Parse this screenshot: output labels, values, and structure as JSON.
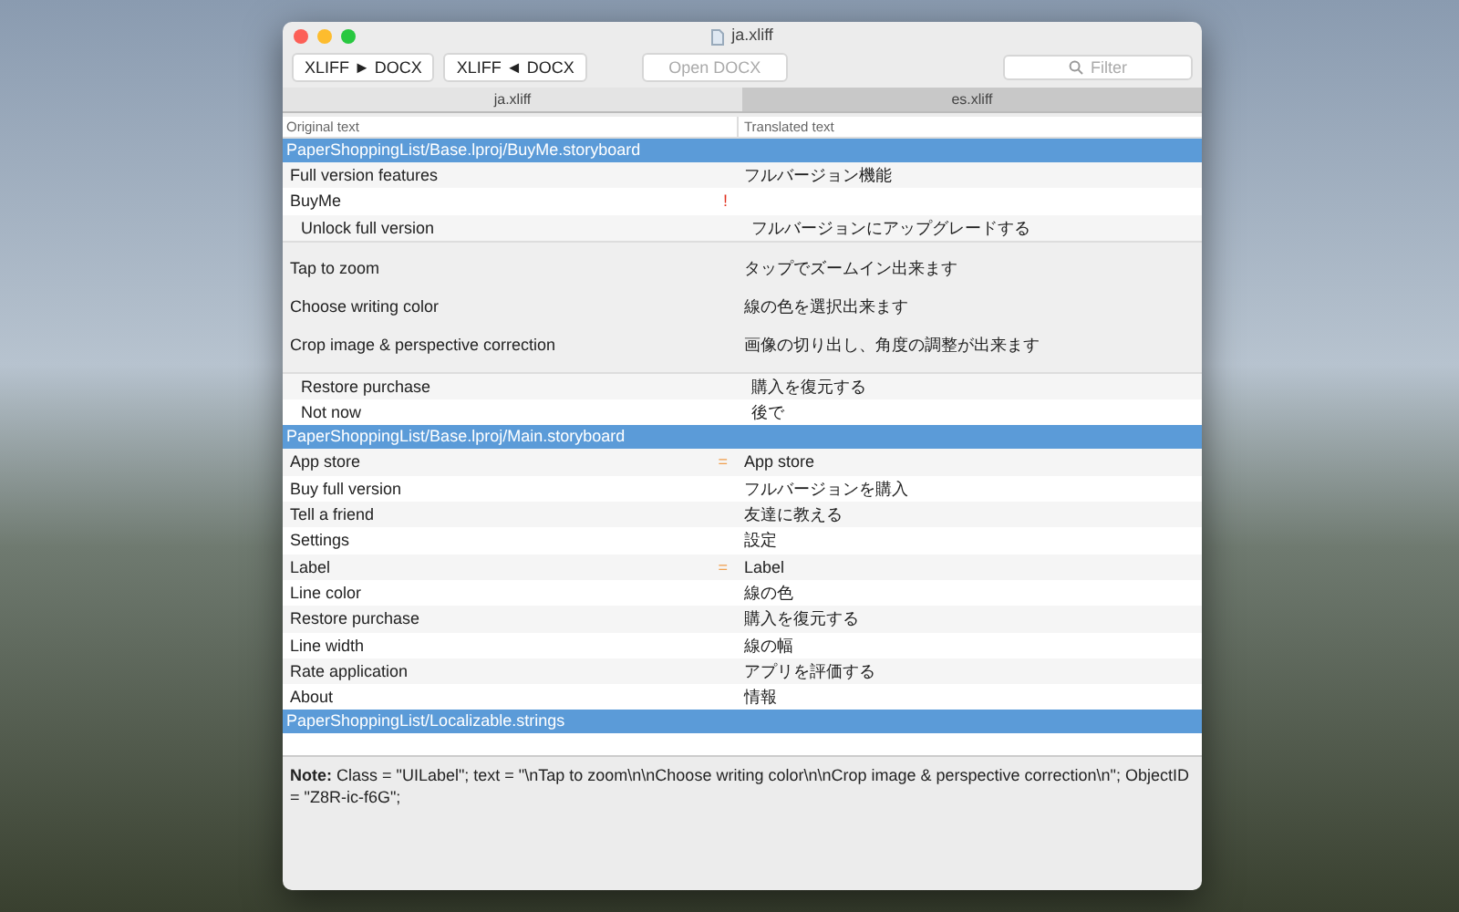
{
  "window": {
    "title": "ja.xliff"
  },
  "toolbar": {
    "buttons": [
      {
        "label": "XLIFF ► DOCX",
        "disabled": false
      },
      {
        "label": "XLIFF ◄ DOCX",
        "disabled": false
      },
      {
        "label": "Open DOCX",
        "disabled": true
      }
    ],
    "search": {
      "placeholder": "Filter"
    }
  },
  "tabs": [
    {
      "label": "ja.xliff",
      "selected": true
    },
    {
      "label": "es.xliff",
      "selected": false
    }
  ],
  "table": {
    "columns": [
      "Original text",
      "Translated text"
    ],
    "groups": [
      {
        "title": "PaperShoppingList/Base.lproj/BuyMe.storyboard",
        "rows": [
          {
            "kind": "row",
            "original": "Full version features",
            "translated": "フルバージョン機能"
          },
          {
            "kind": "row",
            "original": "BuyMe",
            "marker": "!",
            "translated": "",
            "children": [
              {
                "kind": "row",
                "original": "Unlock full version",
                "translated": "フルバージョンにアップグレードする"
              },
              {
                "kind": "block",
                "original_lines": [
                  "Tap to zoom",
                  "Choose writing color",
                  "Crop image & perspective correction"
                ],
                "translated_lines": [
                  "タップでズームイン出来ます",
                  "線の色を選択出来ます",
                  "画像の切り出し、角度の調整が出来ます"
                ],
                "selected": true
              },
              {
                "kind": "row",
                "original": "Restore purchase",
                "translated": "購入を復元する"
              },
              {
                "kind": "row",
                "original": "Not now",
                "translated": "後で"
              }
            ]
          }
        ]
      },
      {
        "title": "PaperShoppingList/Base.lproj/Main.storyboard",
        "rows": [
          {
            "kind": "row",
            "original": "App store",
            "marker": "=",
            "translated": "App store"
          },
          {
            "kind": "row",
            "original": "Buy full version",
            "translated": "フルバージョンを購入"
          },
          {
            "kind": "row",
            "original": "Tell a friend",
            "translated": "友達に教える"
          },
          {
            "kind": "row",
            "original": "Settings",
            "translated": "設定"
          },
          {
            "kind": "row",
            "original": "Label",
            "marker": "=",
            "translated": "Label"
          },
          {
            "kind": "row",
            "original": "Line color",
            "translated": "線の色"
          },
          {
            "kind": "row",
            "original": "Restore purchase",
            "translated": "購入を復元する"
          },
          {
            "kind": "row",
            "original": "Line width",
            "translated": "線の幅"
          },
          {
            "kind": "row",
            "original": "Rate application",
            "translated": "アプリを評価する"
          },
          {
            "kind": "row",
            "original": "About",
            "translated": "情報"
          }
        ]
      },
      {
        "title": "PaperShoppingList/Localizable.strings"
      }
    ]
  },
  "note": "**Note:** Class = \"UILabel\"; text = \"\\nTap to zoom\\n\\nChoose writing color\\n\\nCrop image & perspective correction\\n\"; ObjectID = \"Z8R-ic-f6G\";"
}
